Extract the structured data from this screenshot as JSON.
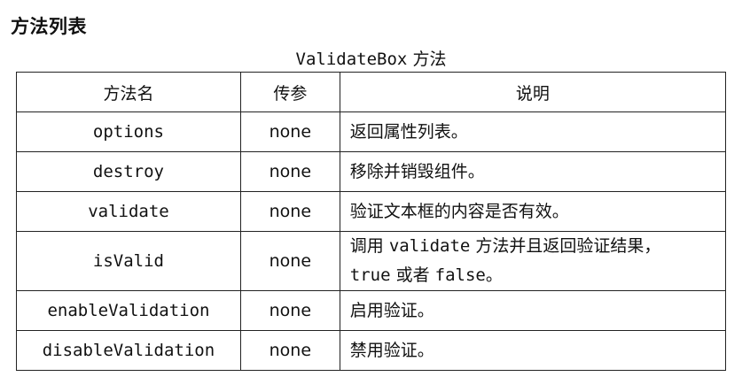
{
  "section_title": "方法列表",
  "caption": {
    "code": "ValidateBox",
    "text": "方法"
  },
  "table": {
    "headers": [
      "方法名",
      "传参",
      "说明"
    ],
    "rows": [
      {
        "name": "options",
        "param": "none",
        "desc": "返回属性列表。"
      },
      {
        "name": "destroy",
        "param": "none",
        "desc": "移除并销毁组件。"
      },
      {
        "name": "validate",
        "param": "none",
        "desc": "验证文本框的内容是否有效。"
      },
      {
        "name": "isValid",
        "param": "none",
        "desc_parts": {
          "code1": "validate",
          "text1": " 方法并且返回验证结果，",
          "code2": "true",
          "text2": " 或者 ",
          "code3": "false",
          "text3": "。",
          "prefix": "调用 "
        }
      },
      {
        "name": "enableValidation",
        "param": "none",
        "desc": "启用验证。"
      },
      {
        "name": "disableValidation",
        "param": "none",
        "desc": "禁用验证。"
      }
    ]
  }
}
